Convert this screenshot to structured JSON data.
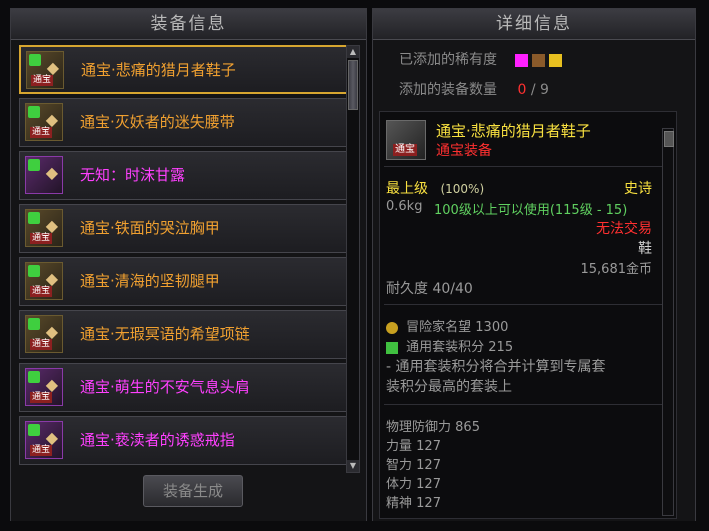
{
  "left_panel": {
    "title": "装备信息",
    "items": [
      {
        "name": "通宝·悲痛的猎月者鞋子",
        "color": "#f0a030",
        "tag": "通宝",
        "selected": true,
        "icon": "boots-icon"
      },
      {
        "name": "通宝·灭妖者的迷失腰带",
        "color": "#f0a030",
        "tag": "通宝",
        "selected": false,
        "icon": "belt-icon"
      },
      {
        "name": "无知：时沫甘露",
        "color": "#ff40ff",
        "tag": "",
        "selected": false,
        "icon": "potion-icon"
      },
      {
        "name": "通宝·铁面的哭泣胸甲",
        "color": "#f0a030",
        "tag": "通宝",
        "selected": false,
        "icon": "chest-armor-icon"
      },
      {
        "name": "通宝·清海的坚韧腿甲",
        "color": "#f0a030",
        "tag": "通宝",
        "selected": false,
        "icon": "leg-armor-icon"
      },
      {
        "name": "通宝·无瑕冥语的希望项链",
        "color": "#f0a030",
        "tag": "通宝",
        "selected": false,
        "icon": "necklace-icon"
      },
      {
        "name": "通宝·萌生的不安气息头肩",
        "color": "#ff40ff",
        "tag": "通宝",
        "selected": false,
        "icon": "shoulder-icon"
      },
      {
        "name": "通宝·亵渎者的诱惑戒指",
        "color": "#ff40ff",
        "tag": "通宝",
        "selected": false,
        "icon": "ring-icon"
      }
    ],
    "generate_button": "装备生成"
  },
  "right_panel": {
    "title": "详细信息",
    "rarity_label": "已添加的稀有度",
    "rarity_colors": [
      "#ff20ff",
      "#8a5a2a",
      "#e8c020"
    ],
    "count_label": "添加的装备数量",
    "count_current": "0",
    "count_sep": "/",
    "count_total": "9",
    "detail": {
      "name": "通宝·悲痛的猎月者鞋子",
      "subtitle": "通宝装备",
      "icon_tag": "通宝",
      "grade": "最上级",
      "grade_pct": "(100%)",
      "rarity": "史诗",
      "weight": "0.6kg",
      "level_req": "100级以上可以使用(115级 - 15)",
      "trade": "无法交易",
      "slot": "鞋",
      "price": "15,681金币",
      "durability": "耐久度 40/40",
      "fame": "冒险家名望 1300",
      "set_score": "通用套装积分 215",
      "note_line1": "- 通用套装积分将合并计算到专属套",
      "note_line2": "装积分最高的套装上",
      "stats": [
        {
          "label": "物理防御力",
          "value": "865"
        },
        {
          "label": "力量",
          "value": "127"
        },
        {
          "label": "智力",
          "value": "127"
        },
        {
          "label": "体力",
          "value": "127"
        },
        {
          "label": "精神",
          "value": "127"
        }
      ]
    }
  }
}
